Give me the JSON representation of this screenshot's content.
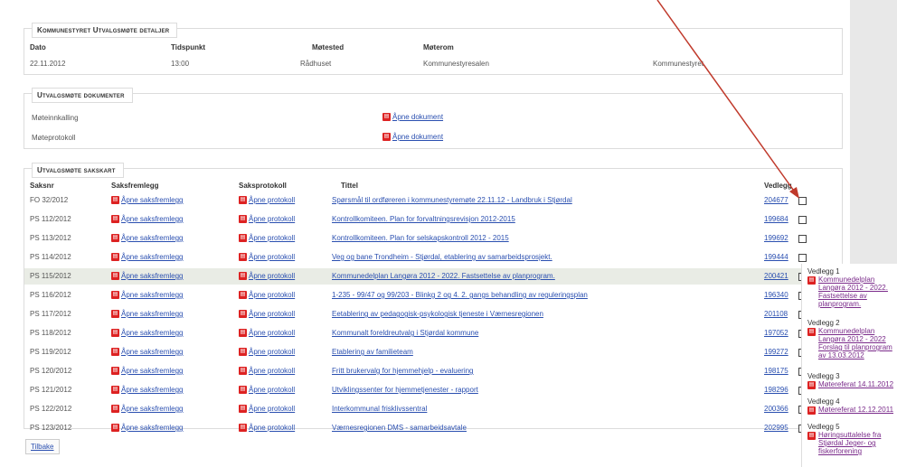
{
  "details": {
    "title": "Kommunestyret Utvalgsmøte detaljer",
    "headers": [
      "Dato",
      "Tidspunkt",
      "Møtested",
      "Møterom"
    ],
    "values": [
      "22.11.2012",
      "13:00",
      "Rådhuset",
      "Kommunestyresalen",
      "Kommunestyret"
    ]
  },
  "documents": {
    "title": "Utvalgsmøte dokumenter",
    "rows": [
      {
        "label": "Møteinnkalling",
        "link": "Åpne dokument"
      },
      {
        "label": "Møteprotokoll",
        "link": "Åpne dokument"
      }
    ]
  },
  "sakskart": {
    "title": "Utvalgsmøte sakskart",
    "headers": [
      "Saksnr",
      "Saksfremlegg",
      "Saksprotokoll",
      "Tittel",
      "Vedlegg"
    ],
    "rows": [
      {
        "saksnr": "FO 32/2012",
        "fremlegg": "Åpne saksfremlegg",
        "protokoll": "Åpne protokoll",
        "tittel": "Spørsmål til ordføreren i kommunestyremøte 22.11.12 - Landbruk i Stjørdal",
        "vedlegg": "204677"
      },
      {
        "saksnr": "PS 112/2012",
        "fremlegg": "Åpne saksfremlegg",
        "protokoll": "Åpne protokoll",
        "tittel": "Kontrollkomiteen. Plan for forvaltningsrevisjon 2012-2015",
        "vedlegg": "199684"
      },
      {
        "saksnr": "PS 113/2012",
        "fremlegg": "Åpne saksfremlegg",
        "protokoll": "Åpne protokoll",
        "tittel": "Kontrollkomiteen. Plan for selskapskontroll 2012 - 2015",
        "vedlegg": "199692"
      },
      {
        "saksnr": "PS 114/2012",
        "fremlegg": "Åpne saksfremlegg",
        "protokoll": "Åpne protokoll",
        "tittel": "Veg og bane Trondheim - Stjørdal, etablering av samarbeidsprosjekt.",
        "vedlegg": "199444"
      },
      {
        "saksnr": "PS 115/2012",
        "fremlegg": "Åpne saksfremlegg",
        "protokoll": "Åpne protokoll",
        "tittel": "Kommunedelplan Langøra 2012 - 2022. Fastsettelse av planprogram.",
        "vedlegg": "200421"
      },
      {
        "saksnr": "PS 116/2012",
        "fremlegg": "Åpne saksfremlegg",
        "protokoll": "Åpne protokoll",
        "tittel": "1-235 - 99/47 og 99/203 - Blinkg 2 og 4. 2. gangs behandling av reguleringsplan",
        "vedlegg": "196340"
      },
      {
        "saksnr": "PS 117/2012",
        "fremlegg": "Åpne saksfremlegg",
        "protokoll": "Åpne protokoll",
        "tittel": "Eetablering av pedagogisk-psykologisk tjeneste i Værnesregionen",
        "vedlegg": "201108"
      },
      {
        "saksnr": "PS 118/2012",
        "fremlegg": "Åpne saksfremlegg",
        "protokoll": "Åpne protokoll",
        "tittel": "Kommunalt foreldreutvalg i Stjørdal kommune",
        "vedlegg": "197052"
      },
      {
        "saksnr": "PS 119/2012",
        "fremlegg": "Åpne saksfremlegg",
        "protokoll": "Åpne protokoll",
        "tittel": "Etablering av familieteam",
        "vedlegg": "199272"
      },
      {
        "saksnr": "PS 120/2012",
        "fremlegg": "Åpne saksfremlegg",
        "protokoll": "Åpne protokoll",
        "tittel": "Fritt brukervalg for hjemmehjelp - evaluering",
        "vedlegg": "198175"
      },
      {
        "saksnr": "PS 121/2012",
        "fremlegg": "Åpne saksfremlegg",
        "protokoll": "Åpne protokoll",
        "tittel": "Utviklingssenter for hjemmetjenester - rapport",
        "vedlegg": "198296"
      },
      {
        "saksnr": "PS 122/2012",
        "fremlegg": "Åpne saksfremlegg",
        "protokoll": "Åpne protokoll",
        "tittel": "Interkommunal frisklivssentral",
        "vedlegg": "200366"
      },
      {
        "saksnr": "PS 123/2012",
        "fremlegg": "Åpne saksfremlegg",
        "protokoll": "Åpne protokoll",
        "tittel": "Værnesregionen DMS - samarbeidsavtale",
        "vedlegg": "202995"
      }
    ],
    "highlighted_row": 4
  },
  "back_label": "Tilbake",
  "vedlegg_popup": [
    {
      "label": "Vedlegg 1",
      "link": "Kommunedelplan Langøra 2012 - 2022. Fastsettelse av planprogram."
    },
    {
      "label": "Vedlegg 2",
      "link": "Kommunedelplan Langøra 2012 - 2022 Forslag til planprogram av 13.03.2012"
    },
    {
      "label": "Vedlegg 3",
      "link": "Møtereferat 14.11.2012"
    },
    {
      "label": "Vedlegg 4",
      "link": "Møtereferat 12.12.2011"
    },
    {
      "label": "Vedlegg 5",
      "link": "Høringsuttalelse fra Stjørdal Jeger- og fiskerforening"
    }
  ],
  "colors": {
    "link": "#2a4fb0",
    "visited": "#7a2a8a",
    "highlight": "#e9ece5",
    "arrow": "#c0392b"
  }
}
